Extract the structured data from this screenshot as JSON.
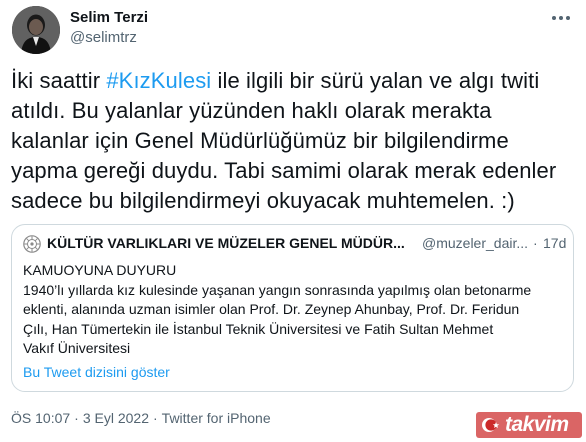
{
  "author": {
    "name": "Selim Terzi",
    "handle": "@selimtrz",
    "avatar_icon": "avatar-portrait"
  },
  "tweet": {
    "line1_pre": "İki saattir ",
    "hashtag": "#KızKulesi",
    "line1_post": " ile ilgili bir sürü yalan ve algı twiti",
    "line2": "atıldı. Bu yalanlar  yüzünden haklı olarak merakta",
    "line3": "kalanlar için Genel Müdürlüğümüz bir bilgilendirme",
    "line4": "yapma gereği duydu. Tabi samimi olarak merak edenler",
    "line5": "sadece bu bilgilendirmeyi okuyacak muhtemelen. :)"
  },
  "quote": {
    "name": "KÜLTÜR VARLIKLARI VE MÜZELER GENEL MÜDÜR...",
    "handle": "@muzeler_dair...",
    "dot": "·",
    "time": "17d",
    "body_lines": [
      "KAMUOYUNA DUYURU",
      "1940’lı yıllarda kız kulesinde yaşanan yangın sonrasında yapılmış olan betonarme",
      "eklenti, alanında uzman isimler olan Prof. Dr. Zeynep Ahunbay, Prof. Dr. Feridun",
      "Çılı, Han Tümertekin ile İstanbul Teknik Üniversitesi ve Fatih Sultan Mehmet",
      "Vakıf Üniversitesi"
    ],
    "show_thread": "Bu Tweet dizisini göster",
    "logo_icon": "ministry-emblem-icon"
  },
  "meta": {
    "time": "ÖS 10:07",
    "sep": "·",
    "date": "3 Eyl 2022",
    "source": "Twitter for iPhone"
  },
  "watermark": {
    "text": "takvim"
  },
  "colors": {
    "link": "#1d9bf0",
    "secondary": "#536471",
    "text": "#0f1419",
    "border": "#cfd9de",
    "watermark": "#cc2a2a"
  }
}
